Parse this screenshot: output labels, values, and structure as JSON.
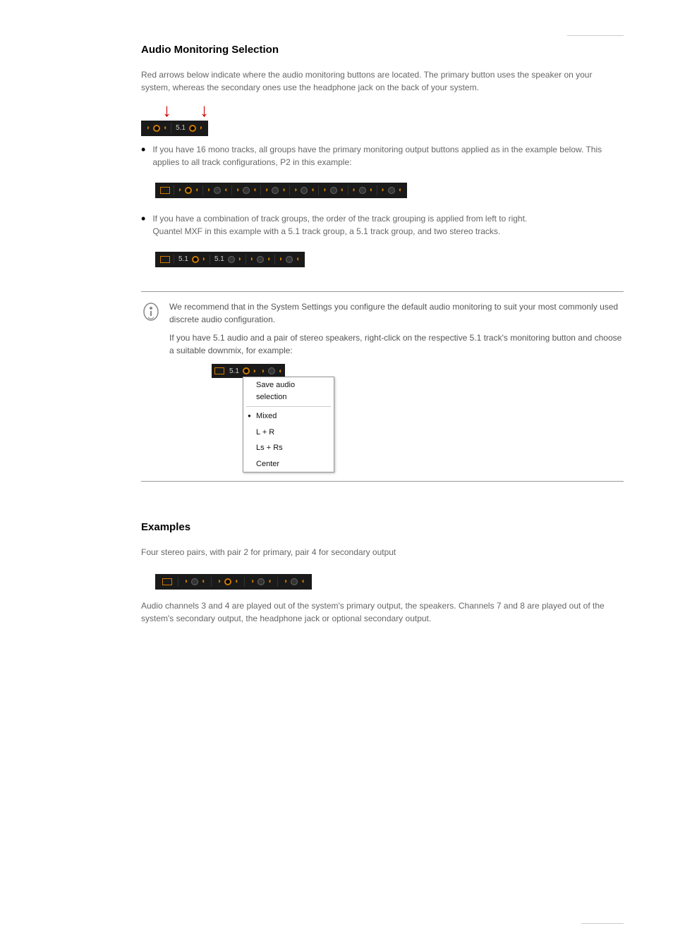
{
  "section1_heading": "Audio Monitoring Selection",
  "intro_text": "Red arrows below indicate where the audio monitoring buttons are located. The primary button uses the speaker on your system, whereas the secondary ones use the headphone jack on the back of your system.",
  "surround_label": "5.1",
  "bullet1": "If you have 16 mono tracks, all groups have the primary monitoring output buttons applied as in the example below. This applies to all track configurations, P2 in this example:",
  "bullet2": "If you have a combination of track groups, the order of the track grouping is applied from left to right.",
  "bullet2_extra": "Quantel MXF in this example with a 5.1 track group, a 5.1 track group, and two stereo tracks.",
  "note_text1": "We recommend that in the System Settings you configure the default audio monitoring to suit your most commonly used discrete audio configuration.",
  "note_text2": "If you have 5.1 audio and a pair of stereo speakers, right-click on the respective 5.1 track's monitoring button and choose a suitable downmix, for example:",
  "dd_save": "Save audio selection",
  "dd_mixed": "Mixed",
  "dd_lr": "L + R",
  "dd_lsrs": "Ls + Rs",
  "dd_center": "Center",
  "section2_heading": "Examples",
  "examples_intro": "Four stereo pairs, with pair 2 for primary, pair 4 for secondary output",
  "examples_after": "Audio channels 3 and 4 are played out of the system's primary output, the speakers. Channels 7 and 8 are played out of the system's secondary output, the headphone jack or optional secondary output.",
  "footer_left": "",
  "footer_right": ""
}
